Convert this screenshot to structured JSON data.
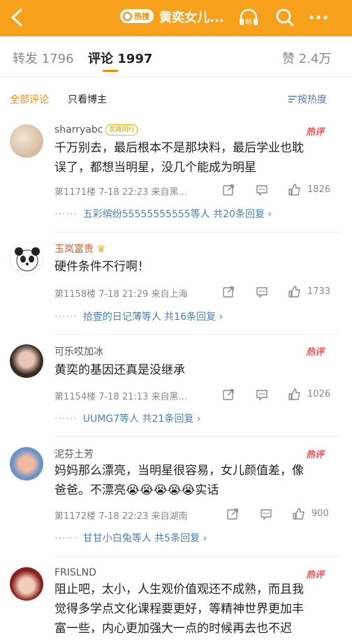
{
  "header": {
    "hot_label": "热搜",
    "title": "黄奕女儿..."
  },
  "tabs": {
    "repost": "转发 1796",
    "comments": "评论 1997",
    "likes": "赞 2.4万"
  },
  "filter": {
    "all": "全部评论",
    "author_only": "只看博主",
    "sort": "按热度"
  },
  "comments": [
    {
      "name": "sharryabc",
      "badge": "奕路同行",
      "text1": "千万别去，最后根本不是那块料，最后学业也耽",
      "text2": "误了，都想当明星，没几个能成为明星",
      "meta": "第1171楼  7-18 22:23  来自黑...",
      "likes": "1826",
      "reply_users": "五彩缤纷55555555555等人",
      "reply_count": "共20条回复 ›",
      "hot": "热评"
    },
    {
      "name": "玉岚富贵",
      "text1": "硬件条件不行啊！",
      "meta": "第1158楼  7-18 21:29  来自上海",
      "likes": "1733",
      "reply_users": "拾壹的日记薄等人",
      "reply_count": "共16条回复 ›"
    },
    {
      "name": "可乐哎加冰",
      "text1": "黄奕的基因还真是没继承",
      "meta": "第1154楼  7-18 21:13  来自黑...",
      "likes": "1026",
      "reply_users": "UUMG7等人",
      "reply_count": "共21条回复 ›",
      "hot": "热评"
    },
    {
      "name": "泥芬土芳",
      "text1": "妈妈那么漂亮，当明星很容易，女儿颜值差，像",
      "text2": "爸爸。不漂亮😭😭😭😭😭实话",
      "meta": "第1172楼  7-18 22:23  来自湖南",
      "likes": "900",
      "reply_users": "甘甘小白兔等人",
      "reply_count": "共5条回复 ›",
      "hot": "热评"
    },
    {
      "name": "FRISLND",
      "text1": "阻止吧，太小，人生观价值观还不成熟，而且我",
      "text2": "觉得多学点文化课程要更好，等精神世界更加丰",
      "text3": "富一些，内心更加强大一点的时候再去也不迟",
      "hot": "热评"
    }
  ],
  "colors": {
    "accent": "#f7a01c",
    "link": "#4a7fb8",
    "hot": "#ff4d4d"
  }
}
